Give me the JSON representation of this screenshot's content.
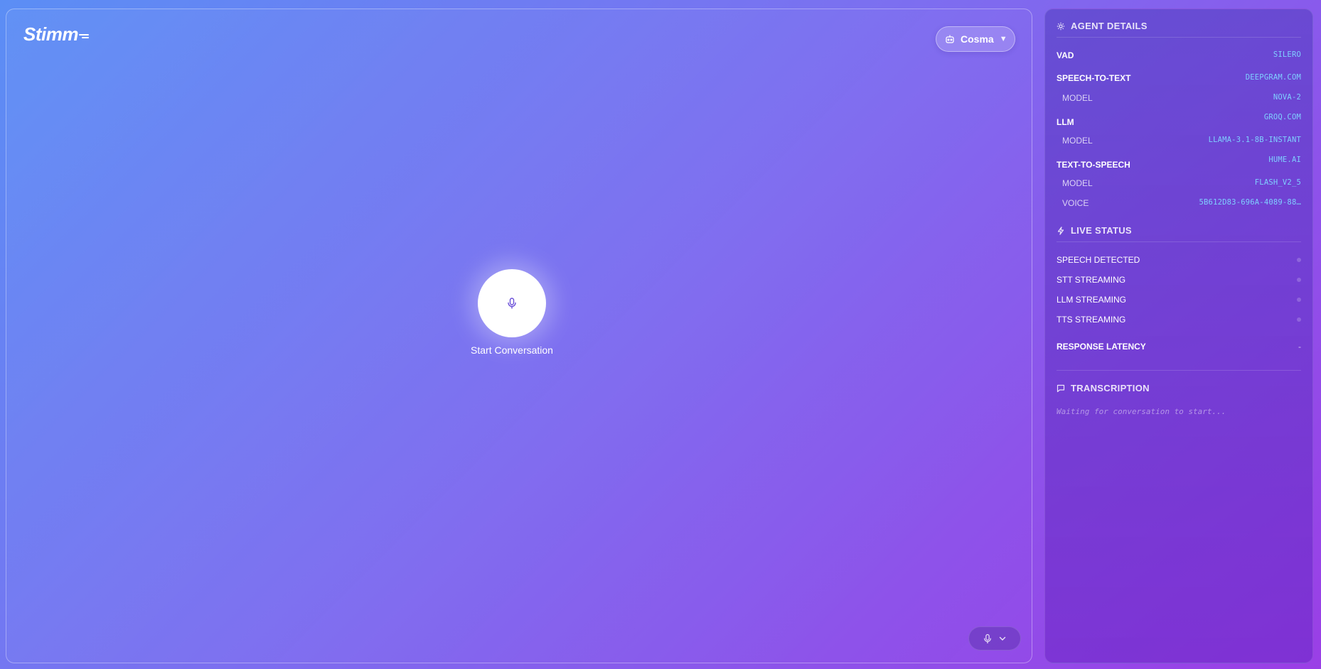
{
  "brand": {
    "logo_text": "Stimm"
  },
  "agent_selector": {
    "selected": "Cosma",
    "icon": "robot-icon"
  },
  "main": {
    "start_label": "Start Conversation",
    "mic_icon": "microphone-icon"
  },
  "sidebar": {
    "agent_details": {
      "title": "AGENT DETAILS",
      "vad": {
        "label": "VAD",
        "value": "SILERO"
      },
      "stt": {
        "label": "SPEECH-TO-TEXT",
        "value": "DEEPGRAM.COM",
        "model_label": "MODEL",
        "model_value": "NOVA-2"
      },
      "llm": {
        "label": "LLM",
        "value": "GROQ.COM",
        "model_label": "MODEL",
        "model_value": "LLAMA-3.1-8B-INSTANT"
      },
      "tts": {
        "label": "TEXT-TO-SPEECH",
        "value": "HUME.AI",
        "model_label": "MODEL",
        "model_value": "FLASH_V2_5",
        "voice_label": "VOICE",
        "voice_value": "5B612D83-696A-4089-88…"
      }
    },
    "live_status": {
      "title": "LIVE STATUS",
      "items": [
        {
          "label": "SPEECH DETECTED"
        },
        {
          "label": "STT STREAMING"
        },
        {
          "label": "LLM STREAMING"
        },
        {
          "label": "TTS STREAMING"
        }
      ],
      "latency_label": "RESPONSE LATENCY",
      "latency_value": "-"
    },
    "transcription": {
      "title": "TRANSCRIPTION",
      "placeholder": "Waiting for conversation to start..."
    }
  }
}
